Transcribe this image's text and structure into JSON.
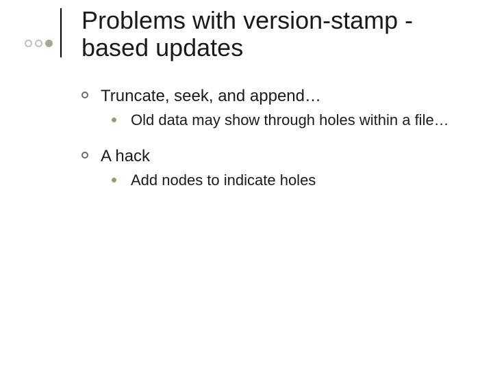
{
  "title": "Problems with version-stamp -based updates",
  "bullets": {
    "b1": "Truncate, seek, and append…",
    "b1_1": "Old data may show through holes within a file…",
    "b2": "A hack",
    "b2_1": "Add nodes to indicate holes"
  }
}
